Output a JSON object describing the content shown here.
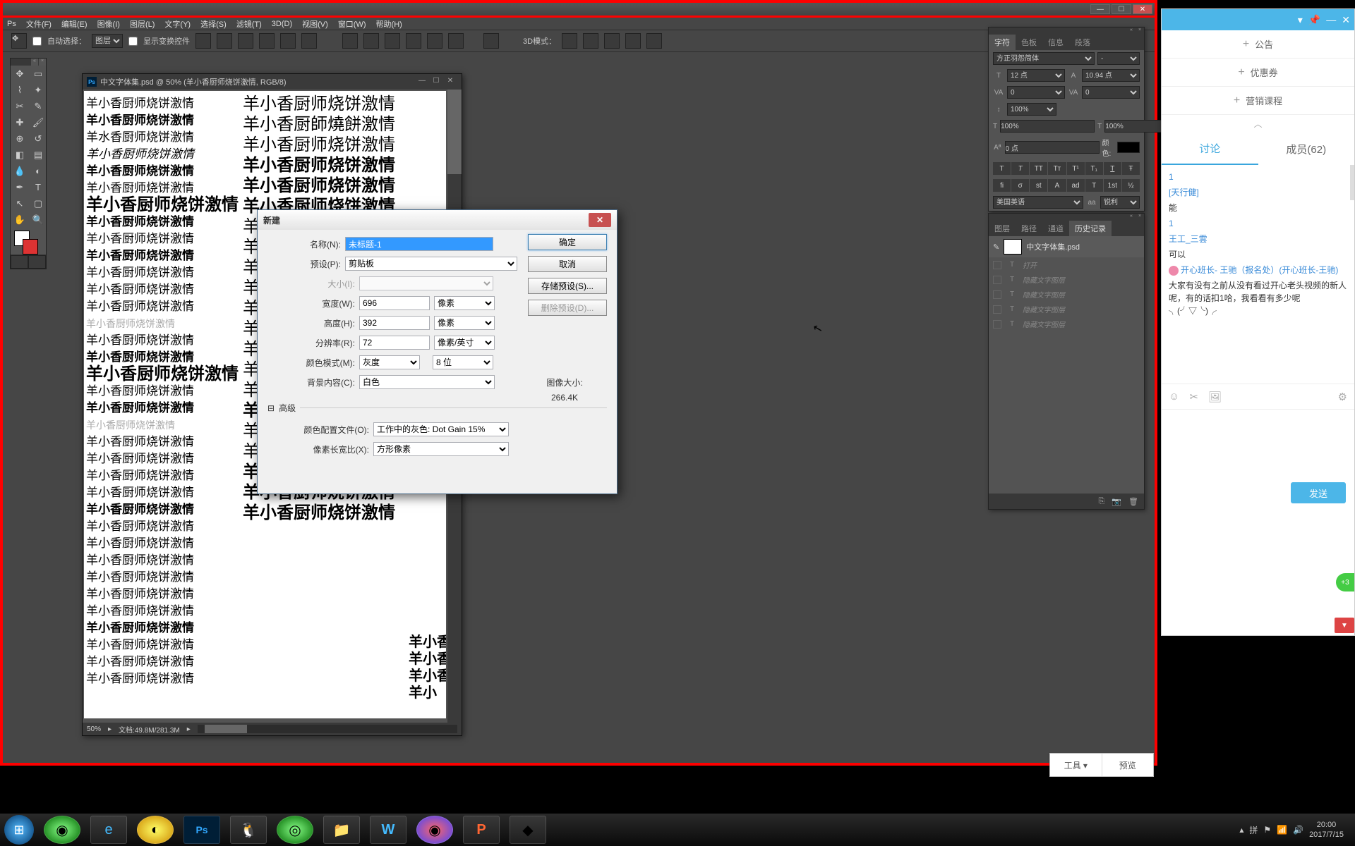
{
  "ps": {
    "logo": "Ps",
    "menu": [
      "文件(F)",
      "编辑(E)",
      "图像(I)",
      "图层(L)",
      "文字(Y)",
      "选择(S)",
      "滤镜(T)",
      "3D(D)",
      "视图(V)",
      "窗口(W)",
      "帮助(H)"
    ],
    "options": {
      "autoSelect": "自动选择：",
      "layerSel": "图层",
      "transformCtrl": "显示变换控件",
      "mode3d": "3D模式："
    }
  },
  "doc": {
    "title": "中文字体集.psd @ 50% (羊小香厨师烧饼激情, RGB/8)",
    "icon": "Ps",
    "zoom": "50%",
    "fileinfo": "文档:49.8M/281.3M",
    "samples_col1": [
      "羊小香厨师烧饼激情",
      "羊小香厨师烧饼激情",
      "羊水香厨师烧饼激情",
      "羊小香厨师烧饼激情",
      "羊小香厨师烧饼激情",
      "羊小香厨师烧饼激情",
      "羊小香厨师烧饼激情",
      "羊小香厨师烧饼激情",
      "羊小香厨师烧饼激情",
      "羊小香厨师烧饼激情",
      "羊小香厨师烧饼激情",
      "羊小香厨师烧饼激情",
      "羊小香厨师烧饼激情",
      "羊小香厨师烧饼激情",
      "羊小香厨师烧饼激情",
      "羊小香厨师烧饼激情",
      "羊小香厨师烧饼激情",
      "羊小香厨师烧饼激情",
      "羊小香厨师烧饼激情",
      "羊小香厨师烧饼激情",
      "羊小香厨师烧饼激情",
      "羊小香厨师烧饼激情",
      "羊小香厨师烧饼激情",
      "羊小香厨师烧饼激情",
      "羊小香厨师烧饼激情",
      "羊小香厨师烧饼激情",
      "羊小香厨师烧饼激情",
      "羊小香厨师烧饼激情",
      "羊小香厨师烧饼激情",
      "羊小香厨师烧饼激情",
      "羊小香厨师烧饼激情",
      "羊小香厨师烧饼激情",
      "羊小香厨师烧饼激情",
      "羊小香厨师烧饼激情",
      "羊小香厨师烧饼激情"
    ],
    "samples_col2": [
      "羊小香厨师烧饼激情",
      "羊小香厨師燒餅激情",
      "羊小香厨师烧饼激情",
      "羊小香厨师烧饼激情",
      "羊小香厨师烧饼激情",
      "羊小香厨师烧饼激情",
      "羊小香厨师烧饼激情",
      "羊小香厨师烧饼激情",
      "羊小香厨师烧饼激情",
      "羊小香厨师烧饼激情",
      "羊小香厨师烧饼激情",
      "羊小香厨师烧饼激情",
      "羊小香厨师烧饼激情",
      "羊小香厨师烧饼激情",
      "羊小香厨师烧饼激情",
      "羊小香厨师烧饼激情",
      "羊小香厨师烧饼激情",
      "羊小香厨师烧饼激情",
      "羊小香厨师烧饼激情",
      "羊小香厨师烧饼激情",
      "羊小香厨师烧饼激情"
    ],
    "samples_col3": [
      "羊小香",
      "羊小香",
      "羊小香",
      "羊小"
    ]
  },
  "dialog": {
    "title": "新建",
    "name_label": "名称(N):",
    "name_value": "未标题-1",
    "preset_label": "预设(P):",
    "preset_value": "剪贴板",
    "size_label": "大小(I):",
    "width_label": "宽度(W):",
    "width_value": "696",
    "width_unit": "像素",
    "height_label": "高度(H):",
    "height_value": "392",
    "height_unit": "像素",
    "res_label": "分辨率(R):",
    "res_value": "72",
    "res_unit": "像素/英寸",
    "mode_label": "颜色模式(M):",
    "mode_value": "灰度",
    "mode_bits": "8 位",
    "bg_label": "背景内容(C):",
    "bg_value": "白色",
    "adv_label": "高级",
    "profile_label": "颜色配置文件(O):",
    "profile_value": "工作中的灰色: Dot Gain 15%",
    "aspect_label": "像素长宽比(X):",
    "aspect_value": "方形像素",
    "imgsize_label": "图像大小:",
    "imgsize_value": "266.4K",
    "btn_ok": "确定",
    "btn_cancel": "取消",
    "btn_save": "存储预设(S)...",
    "btn_del": "删除预设(D)..."
  },
  "char_panel": {
    "tabs": [
      "字符",
      "色板",
      "信息",
      "段落"
    ],
    "font": "方正羽怨简体",
    "style": "-",
    "size": "12 点",
    "leading": "10.94 点",
    "tracking": "0",
    "kerning": "0",
    "vscale": "100%",
    "baseline": "0 点",
    "hscale": "100%",
    "color": "#000000",
    "lang": "美国英语",
    "aa": "aa",
    "sharp": "锐利"
  },
  "hist_panel": {
    "tabs": [
      "图层",
      "路径",
      "通道",
      "历史记录"
    ],
    "file": "中文字体集.psd",
    "rows": [
      "打开",
      "隐藏文字图层",
      "隐藏文字图层",
      "隐藏文字图层",
      "隐藏文字图层"
    ]
  },
  "chat": {
    "nav": [
      "公告",
      "优惠券",
      "营销课程"
    ],
    "tab_discuss": "讨论",
    "tab_members": "成员(62)",
    "msgs": [
      {
        "u": "1",
        "t": ""
      },
      {
        "u": "[天行健]",
        "t": ""
      },
      {
        "u": "",
        "t": "能"
      },
      {
        "u": "1",
        "t": ""
      },
      {
        "u": "王工_三雲",
        "t": ""
      },
      {
        "u": "",
        "t": "可以"
      },
      {
        "u": "开心班长- 王驰（报名处）(开心班长-王驰)",
        "t": "",
        "av": true
      },
      {
        "u": "",
        "t": "大家有没有之前从没有看过开心老头视频的新人呢，有的话扣1哈，我看看有多少呢╮(╯▽╰)╭"
      }
    ],
    "send": "发送",
    "badge": "+3"
  },
  "toolprev": {
    "tools": "工具 ▾",
    "preview": "预览"
  },
  "taskbar": {
    "time": "20:00",
    "date": "2017/7/15"
  }
}
